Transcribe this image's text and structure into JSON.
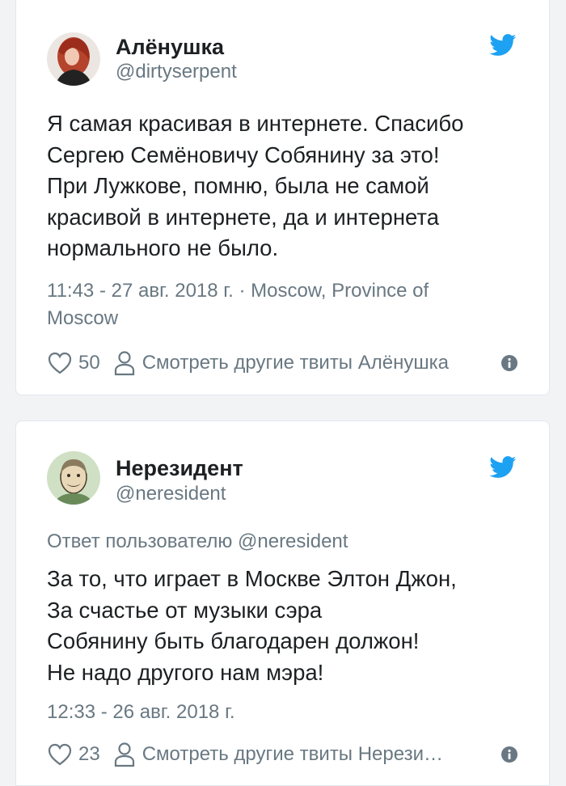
{
  "colors": {
    "text": "#1c2022",
    "secondary": "#697882",
    "twitter_blue": "#1da1f2",
    "border": "#e1e8ed",
    "background": "#f2f3f5"
  },
  "tweets": [
    {
      "name": "Алёнушка",
      "handle": "@dirtyserpent",
      "reply_to": "",
      "lines": [
        "Я самая красивая в интернете. Спасибо",
        "Сергею Семёновичу Собянину за это!",
        "При Лужкове, помню, была не самой",
        "красивой в интернете, да и интернета",
        "нормального не было."
      ],
      "meta_line1": "11:43 - 27 авг. 2018 г. · Moscow, Province of",
      "meta_line2": "Moscow",
      "likes": "50",
      "more_label": "Смотреть другие твиты Алёнушка",
      "icons": [
        "avatar",
        "twitter-bird-icon",
        "heart-icon",
        "person-icon",
        "info-icon"
      ]
    },
    {
      "name": "Нерезидент",
      "handle": "@neresident",
      "reply_to": "Ответ пользователю @neresident",
      "lines": [
        "За то, что играет в Москве Элтон Джон,",
        "За счастье от музыки сэра",
        "Собянину быть благодарен должон!",
        "Не надо другого нам мэра!"
      ],
      "meta_line1": "12:33 - 26 авг. 2018 г.",
      "meta_line2": "",
      "likes": "23",
      "more_label": "Смотреть другие твиты Нерези…",
      "icons": [
        "avatar",
        "twitter-bird-icon",
        "heart-icon",
        "person-icon",
        "info-icon"
      ]
    }
  ]
}
